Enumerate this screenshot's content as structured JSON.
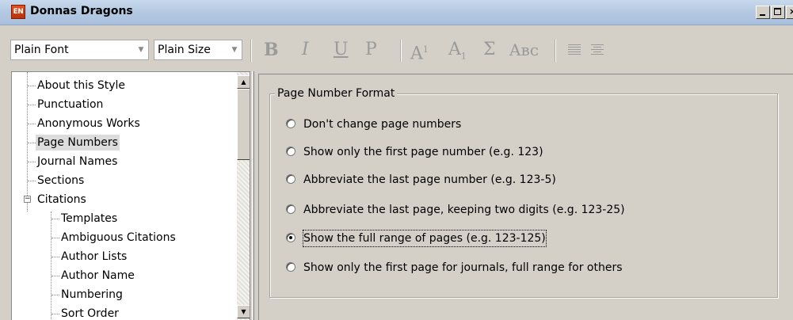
{
  "window": {
    "icon_text": "EN",
    "title": "Donnas Dragons",
    "controls": {
      "minimize": "_",
      "maximize": "□",
      "close": "×"
    }
  },
  "toolbar": {
    "font_select": "Plain Font",
    "size_select": "Plain Size",
    "format_buttons": {
      "bold": "B",
      "italic": "I",
      "underline": "U",
      "plain": "P",
      "superscript_base": "A",
      "superscript_mark": "1",
      "subscript_base": "A",
      "subscript_mark": "1",
      "sigma": "Σ",
      "small_caps": "Aʙᴄ"
    },
    "icons": [
      "justify-icon",
      "center-align-icon"
    ]
  },
  "tree": {
    "items": [
      {
        "label": "About this Style"
      },
      {
        "label": "Punctuation"
      },
      {
        "label": "Anonymous Works"
      },
      {
        "label": "Page Numbers",
        "selected": true
      },
      {
        "label": "Journal Names"
      },
      {
        "label": "Sections"
      },
      {
        "label": "Citations",
        "expander": "−"
      },
      {
        "label": "Templates"
      },
      {
        "label": "Ambiguous Citations"
      },
      {
        "label": "Author Lists"
      },
      {
        "label": "Author Name"
      },
      {
        "label": "Numbering"
      },
      {
        "label": "Sort Order"
      }
    ],
    "scroll": {
      "up": "▲",
      "down": "▼"
    }
  },
  "page_number_format": {
    "legend": "Page Number Format",
    "options": [
      {
        "label": "Don't change page numbers",
        "checked": false
      },
      {
        "label": "Show only the first page number (e.g. 123)",
        "checked": false
      },
      {
        "label": "Abbreviate the last page number (e.g. 123-5)",
        "checked": false
      },
      {
        "label": "Abbreviate the last page, keeping two digits (e.g. 123-25)",
        "checked": false
      },
      {
        "label": "Show the full range of pages (e.g. 123-125)",
        "checked": true
      },
      {
        "label": "Show only the first page for journals, full range for others",
        "checked": false
      }
    ]
  }
}
